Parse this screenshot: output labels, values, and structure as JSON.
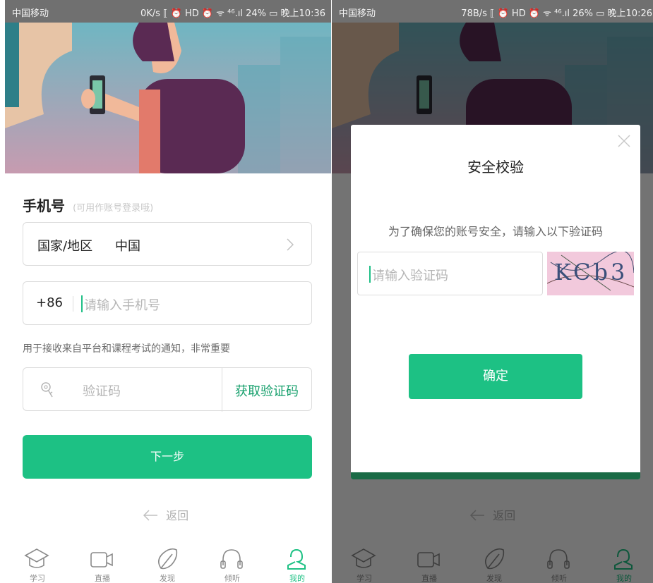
{
  "colors": {
    "accent": "#1dc184",
    "accent_dark": "#1a6b46",
    "border": "#dcdcdc",
    "placeholder": "#b5b5b5",
    "overlay": "rgba(0,0,0,0.55)"
  },
  "left": {
    "status": {
      "carrier": "中国移动",
      "info": "0K/s ⟦ ⏰ HD ⏰ ᯤ ⁴⁶.ıl 24% ▭ 晚上10:36"
    },
    "phone_label": "手机号",
    "phone_hint": "(可用作账号登录哦)",
    "region": {
      "label": "国家/地区",
      "value": "中国",
      "icon": "chevron-right-icon"
    },
    "phone": {
      "prefix": "+86",
      "placeholder": "请输入手机号"
    },
    "notice": "用于接收来自平台和课程考试的通知，非常重要",
    "code": {
      "placeholder": "验证码",
      "icon": "key-icon",
      "get_button": "获取验证码"
    },
    "next_button": "下一步",
    "back": {
      "icon": "arrow-left-icon",
      "label": "返回"
    },
    "tabs": [
      {
        "label": "学习",
        "icon": "graduation-cap-icon"
      },
      {
        "label": "直播",
        "icon": "video-camera-icon"
      },
      {
        "label": "发现",
        "icon": "compass-icon"
      },
      {
        "label": "倾听",
        "icon": "headphones-icon"
      },
      {
        "label": "我的",
        "icon": "user-icon",
        "active": true
      }
    ]
  },
  "right": {
    "status": {
      "carrier": "中国移动",
      "info": "78B/s ⟦ ⏰ HD ⏰ ᯤ ⁴⁶.ıl 26% ▭ 晚上10:26"
    },
    "modal": {
      "title": "安全校验",
      "message": "为了确保您的账号安全，请输入以下验证码",
      "input_placeholder": "请输入验证码",
      "captcha_text": "KCb3",
      "confirm_button": "确定",
      "close_icon": "close-icon"
    },
    "back": {
      "label": "返回"
    },
    "tabs": [
      {
        "label": "学习"
      },
      {
        "label": "直播"
      },
      {
        "label": "发现"
      },
      {
        "label": "倾听"
      },
      {
        "label": "我的",
        "active": true
      }
    ]
  }
}
